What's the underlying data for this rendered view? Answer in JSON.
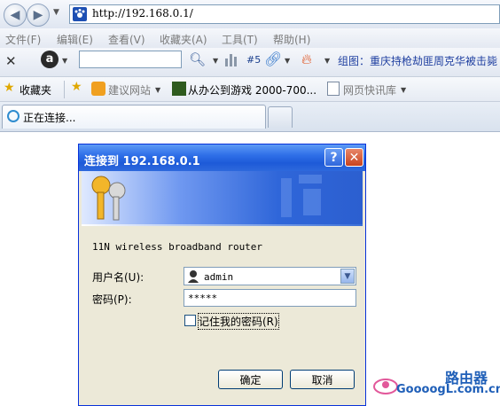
{
  "browser": {
    "url": "http://192.168.0.1/",
    "menu": [
      "文件(F)",
      "编辑(E)",
      "查看(V)",
      "收藏夹(A)",
      "工具(T)",
      "帮助(H)"
    ],
    "toolbar": {
      "badge_count": "#5",
      "news_text": "组图：重庆持枪劫匪周克华被击毙"
    },
    "favorites": {
      "favorites_label": "收藏夹",
      "items": [
        "建议网站",
        "从办公到游戏 2000-700...",
        "网页快讯库"
      ]
    },
    "tab": {
      "title": "正在连接..."
    }
  },
  "dialog": {
    "title": "连接到 192.168.0.1",
    "help_label": "?",
    "close_label": "✕",
    "device_name": "11N wireless broadband router",
    "username_label": "用户名(U):",
    "username_value": "admin",
    "password_label": "密码(P):",
    "password_value": "*****",
    "remember_label": "记住我的密码(R)",
    "ok_label": "确定",
    "cancel_label": "取消"
  },
  "watermark": {
    "title": "路由器",
    "url": "GoooogL.com.cn"
  },
  "colors": {
    "title_bar": "#2f6fe8",
    "dialog_bg": "#ece9d8",
    "link_blue": "#1f3fa0"
  }
}
